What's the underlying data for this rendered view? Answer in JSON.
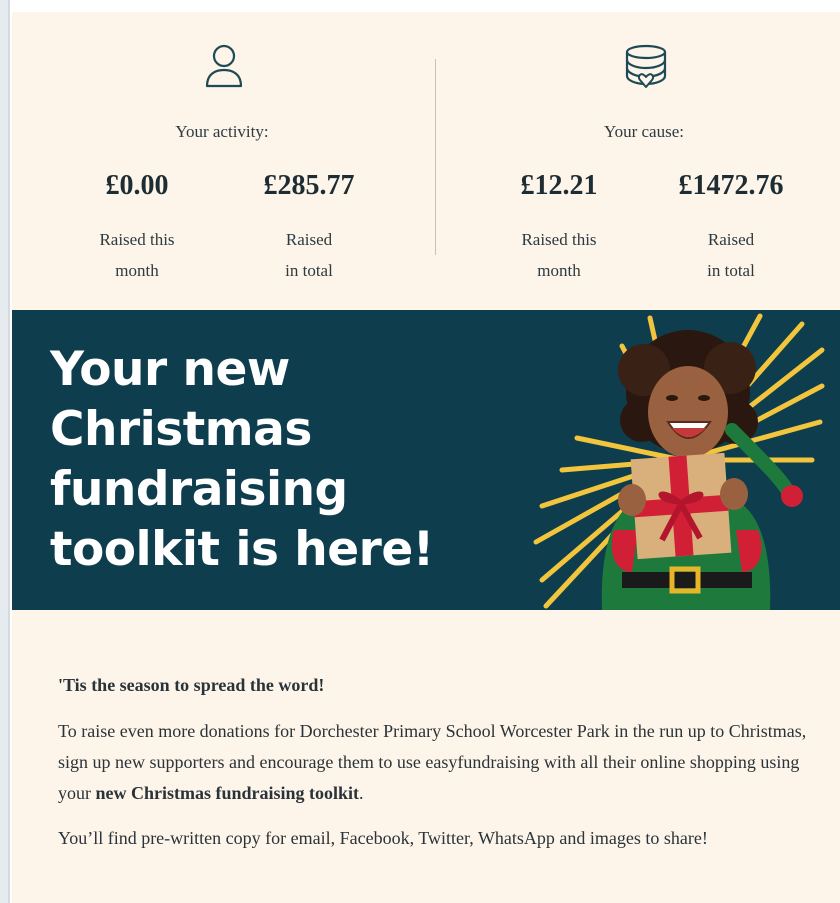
{
  "stats": {
    "activity": {
      "heading": "Your activity:",
      "icon": "user-icon",
      "month_amount": "£0.00",
      "month_label_1": "Raised this",
      "month_label_2": "month",
      "total_amount": "£285.77",
      "total_label_1": "Raised",
      "total_label_2": "in total"
    },
    "cause": {
      "heading": "Your cause:",
      "icon": "coin-stack-heart-icon",
      "month_amount": "£12.21",
      "month_label_1": "Raised this",
      "month_label_2": "month",
      "total_amount": "£1472.76",
      "total_label_1": "Raised",
      "total_label_2": "in total"
    }
  },
  "banner": {
    "line_1": "Your new",
    "line_2": "Christmas",
    "line_3": "fundraising",
    "line_4": "toolkit is here!",
    "image": "child-elf-holding-gift-illustration",
    "colors": {
      "background": "#0e3e4d",
      "rays": "#f2c53d",
      "gift_ribbon": "#d11f36"
    }
  },
  "body": {
    "lead": "'Tis the season to spread the word!",
    "para_1_pre": "To raise even more donations for Dorchester Primary School Worcester Park in the run up to Christmas, sign up new supporters and encourage them to use easyfundraising with all their online shopping using your ",
    "para_1_bold": "new Christmas fundraising toolkit",
    "para_1_post": ".",
    "para_2": "You’ll find pre-written copy for email, Facebook, Twitter, WhatsApp and images to share!"
  }
}
